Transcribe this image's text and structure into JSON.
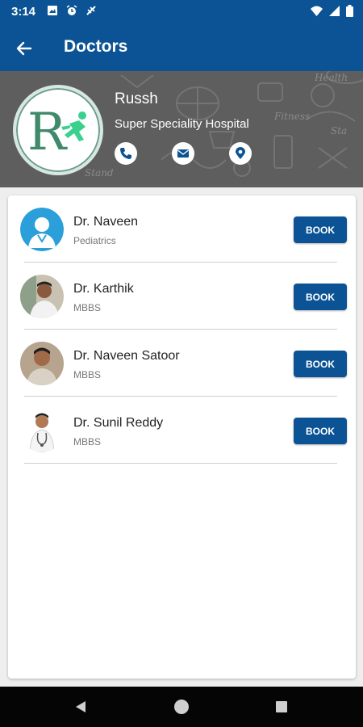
{
  "status_bar": {
    "time": "3:14",
    "left_icons": [
      "image-icon",
      "alarm-icon",
      "no-signal-icon"
    ],
    "right_icons": [
      "wifi-icon",
      "signal-icon",
      "battery-icon"
    ]
  },
  "app_bar": {
    "title": "Doctors",
    "back_icon": "arrow-left-icon"
  },
  "hospital": {
    "logo_letter": "R",
    "name": "Russh",
    "subtitle": "Super Speciality Hospital",
    "contact_icons": [
      "phone-icon",
      "mail-icon",
      "location-icon"
    ]
  },
  "doctors": [
    {
      "name": "Dr. Naveen",
      "specialty": "Pediatrics",
      "button": "BOOK"
    },
    {
      "name": "Dr. Karthik",
      "specialty": "MBBS",
      "button": "BOOK"
    },
    {
      "name": "Dr. Naveen Satoor",
      "specialty": "MBBS",
      "button": "BOOK"
    },
    {
      "name": "Dr. Sunil Reddy",
      "specialty": "MBBS",
      "button": "BOOK"
    }
  ],
  "nav_bar": {
    "icons": [
      "back-triangle-icon",
      "home-circle-icon",
      "recents-square-icon"
    ]
  },
  "colors": {
    "primary": "#0b5394",
    "banner": "#5e5e5e",
    "logo_green": "#3f8a6a",
    "background": "#eeeeee"
  }
}
